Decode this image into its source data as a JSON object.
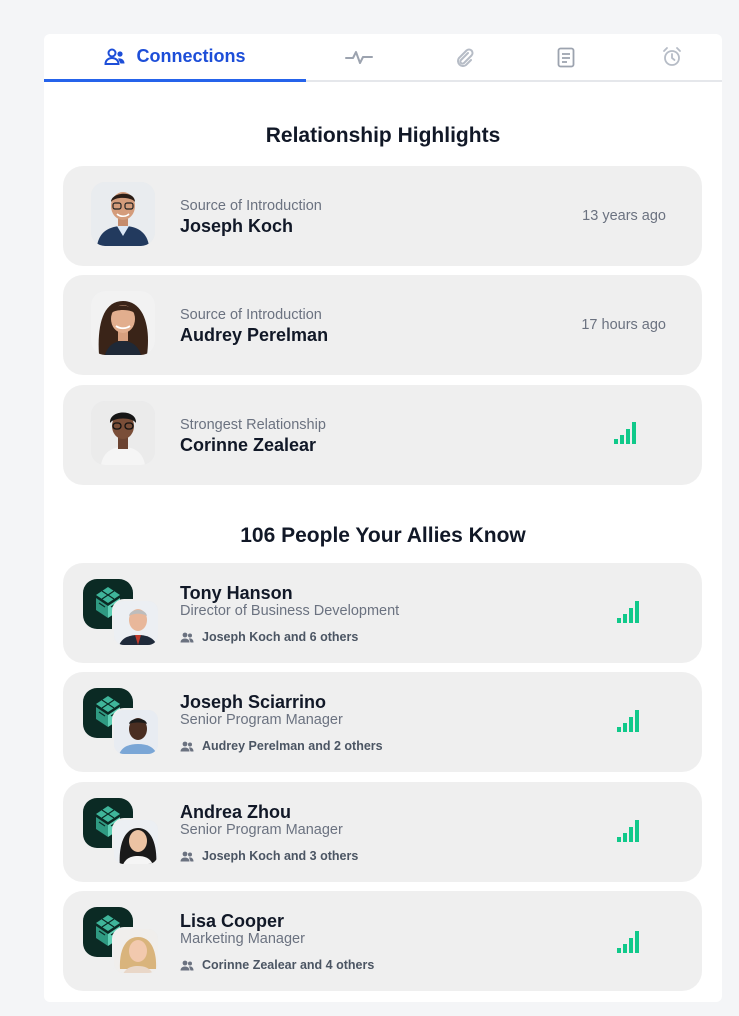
{
  "tabs": {
    "connections_label": "Connections"
  },
  "highlights": {
    "title": "Relationship Highlights",
    "items": [
      {
        "subtitle": "Source of Introduction",
        "name": "Joseph Koch",
        "time": "13 years ago"
      },
      {
        "subtitle": "Source of Introduction",
        "name": "Audrey Perelman",
        "time": "17 hours ago"
      },
      {
        "subtitle": "Strongest Relationship",
        "name": "Corinne Zealear",
        "strength": 4
      }
    ]
  },
  "allies": {
    "title": "106 People Your Allies Know",
    "items": [
      {
        "name": "Tony Hanson",
        "title": "Director of Business Development",
        "mutual": "Joseph Koch and 6 others",
        "strength": 4
      },
      {
        "name": "Joseph Sciarrino",
        "title": "Senior Program Manager",
        "mutual": "Audrey Perelman and 2 others",
        "strength": 4
      },
      {
        "name": "Andrea Zhou",
        "title": "Senior Program Manager",
        "mutual": "Joseph Koch and 3 others",
        "strength": 4
      },
      {
        "name": "Lisa Cooper",
        "title": "Marketing Manager",
        "mutual": "Corinne Zealear and 4 others",
        "strength": 4
      }
    ]
  },
  "colors": {
    "accent": "#2563eb",
    "strength": "#10c98a",
    "row_bg": "#efefef"
  },
  "icons": [
    "people-icon",
    "activity-icon",
    "paperclip-icon",
    "document-icon",
    "alarm-clock-icon",
    "signal-strength-icon"
  ]
}
